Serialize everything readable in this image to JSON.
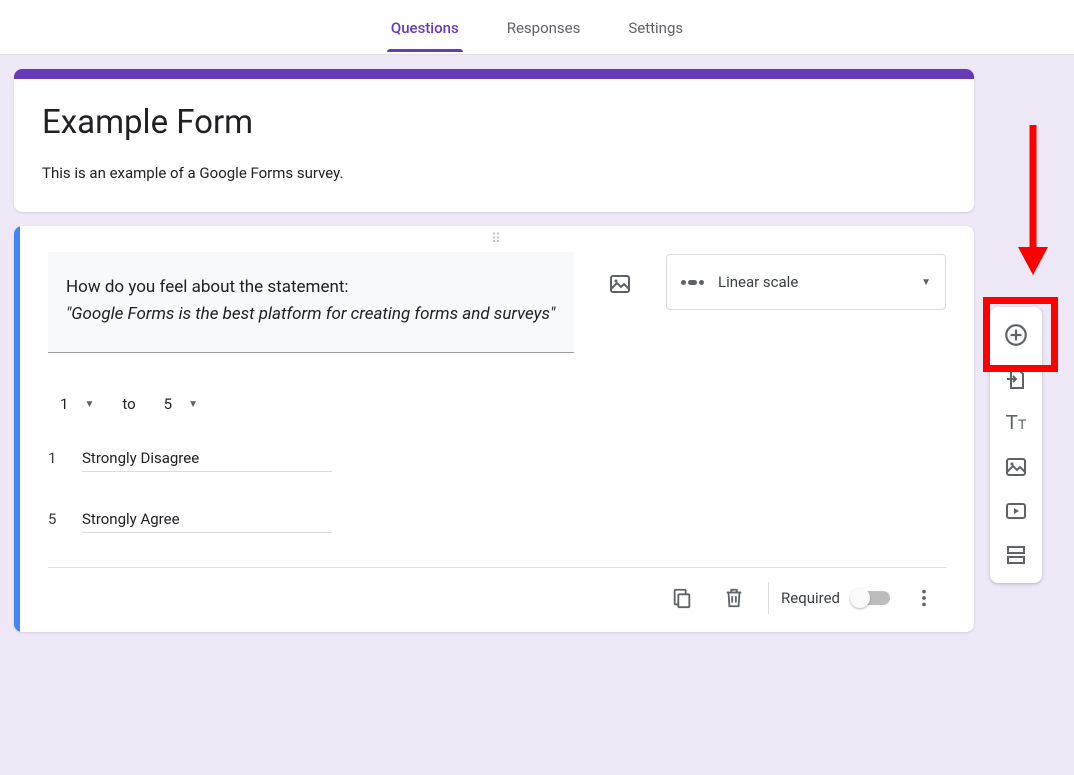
{
  "tabs": {
    "questions": "Questions",
    "responses": "Responses",
    "settings": "Settings",
    "active": "questions"
  },
  "form": {
    "title": "Example Form",
    "description": "This is an example of a Google Forms survey."
  },
  "question": {
    "text_line1": "How do you feel about the statement:",
    "text_line2": "\"Google Forms is the best platform for creating forms and surveys\"",
    "type_label": "Linear scale",
    "range": {
      "from": "1",
      "to_word": "to",
      "to": "5"
    },
    "labels": {
      "low_num": "1",
      "low_text": "Strongly Disagree",
      "high_num": "5",
      "high_text": "Strongly Agree"
    },
    "required_label": "Required"
  },
  "side_toolbar_icons": {
    "add_question": "add-question",
    "import_questions": "import-questions",
    "add_title": "add-title-description",
    "add_image": "add-image",
    "add_video": "add-video",
    "add_section": "add-section"
  },
  "annotation": {
    "highlight_target": "add-question-button",
    "arrow_color": "#ff0000"
  }
}
